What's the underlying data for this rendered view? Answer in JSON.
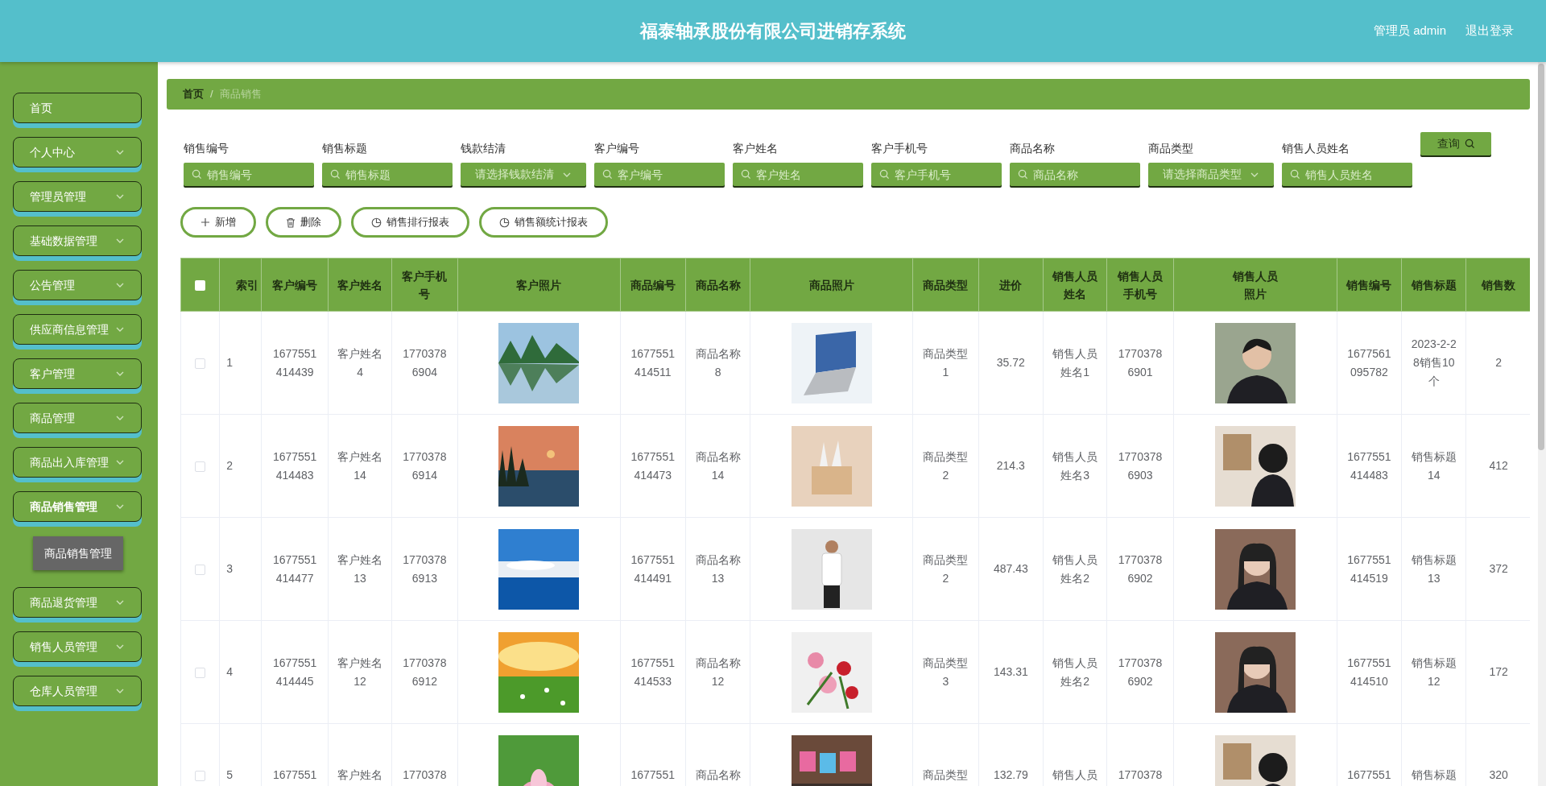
{
  "header": {
    "title": "福泰轴承股份有限公司进销存系统",
    "user": "管理员 admin",
    "logout": "退出登录"
  },
  "sidebar": {
    "items": [
      {
        "label": "首页",
        "kind": "link",
        "expanded": false
      },
      {
        "label": "个人中心",
        "kind": "menu",
        "expanded": false
      },
      {
        "label": "管理员管理",
        "kind": "menu",
        "expanded": false
      },
      {
        "label": "基础数据管理",
        "kind": "menu",
        "expanded": false
      },
      {
        "label": "公告管理",
        "kind": "menu",
        "expanded": false
      },
      {
        "label": "供应商信息管理",
        "kind": "menu",
        "expanded": false
      },
      {
        "label": "客户管理",
        "kind": "menu",
        "expanded": false
      },
      {
        "label": "商品管理",
        "kind": "menu",
        "expanded": false
      },
      {
        "label": "商品出入库管理",
        "kind": "menu",
        "expanded": false
      },
      {
        "label": "商品销售管理",
        "kind": "menu",
        "expanded": true,
        "children": [
          {
            "label": "商品销售管理",
            "selected": true
          }
        ]
      },
      {
        "label": "商品退货管理",
        "kind": "menu",
        "expanded": false
      },
      {
        "label": "销售人员管理",
        "kind": "menu",
        "expanded": false
      },
      {
        "label": "仓库人员管理",
        "kind": "menu",
        "expanded": false
      }
    ]
  },
  "breadcrumb": {
    "separator": "/",
    "items": [
      "首页",
      "商品销售"
    ]
  },
  "filters": [
    {
      "label": "销售编号",
      "kind": "search",
      "placeholder": "销售编号"
    },
    {
      "label": "销售标题",
      "kind": "search",
      "placeholder": "销售标题"
    },
    {
      "label": "钱款结清",
      "kind": "select",
      "placeholder": "请选择钱款结清"
    },
    {
      "label": "客户编号",
      "kind": "search",
      "placeholder": "客户编号"
    },
    {
      "label": "客户姓名",
      "kind": "search",
      "placeholder": "客户姓名"
    },
    {
      "label": "客户手机号",
      "kind": "search",
      "placeholder": "客户手机号"
    },
    {
      "label": "商品名称",
      "kind": "search",
      "placeholder": "商品名称"
    },
    {
      "label": "商品类型",
      "kind": "select",
      "placeholder": "请选择商品类型"
    },
    {
      "label": "销售人员姓名",
      "kind": "search",
      "placeholder": "销售人员姓名"
    }
  ],
  "query_button": "查询",
  "actions": [
    {
      "label": "新增",
      "kind": "add"
    },
    {
      "label": "删除",
      "kind": "delete"
    },
    {
      "label": "销售排行报表",
      "kind": "report"
    },
    {
      "label": "销售额统计报表",
      "kind": "report"
    }
  ],
  "table": {
    "select_all": {
      "checked": false
    },
    "columns": [
      {
        "label": "索引",
        "kind": "text"
      },
      {
        "label": "客户编号",
        "kind": "text"
      },
      {
        "label": "客户姓名",
        "kind": "text"
      },
      {
        "label": "客户手机号",
        "kind": "text"
      },
      {
        "label": "客户照片",
        "kind": "picture"
      },
      {
        "label": "商品编号",
        "kind": "text"
      },
      {
        "label": "商品名称",
        "kind": "text"
      },
      {
        "label": "商品照片",
        "kind": "picture"
      },
      {
        "label": "商品类型",
        "kind": "text"
      },
      {
        "label": "进价",
        "kind": "text"
      },
      {
        "label": "销售人员姓名",
        "kind": "text"
      },
      {
        "label": "销售人员手机号",
        "kind": "text"
      },
      {
        "label": "销售人员照片",
        "kind": "picture"
      },
      {
        "label": "销售编号",
        "kind": "text"
      },
      {
        "label": "销售标题",
        "kind": "text"
      },
      {
        "label": "销售数",
        "kind": "text"
      }
    ],
    "rows": [
      {
        "checked": false,
        "cells": [
          "1",
          "1677551414439",
          "客户姓名4",
          "17703786904",
          null,
          "1677551414511",
          "商品名称8",
          null,
          "商品类型1",
          "35.72",
          "销售人员姓名1",
          "17703786901",
          null,
          "1677561095782",
          "2023-2-28销售10个",
          "2"
        ]
      },
      {
        "checked": false,
        "cells": [
          "2",
          "1677551414483",
          "客户姓名14",
          "17703786914",
          null,
          "1677551414473",
          "商品名称14",
          null,
          "商品类型2",
          "214.3",
          "销售人员姓名3",
          "17703786903",
          null,
          "1677551414483",
          "销售标题14",
          "412"
        ]
      },
      {
        "checked": false,
        "cells": [
          "3",
          "1677551414477",
          "客户姓名13",
          "17703786913",
          null,
          "1677551414491",
          "商品名称13",
          null,
          "商品类型2",
          "487.43",
          "销售人员姓名2",
          "17703786902",
          null,
          "1677551414519",
          "销售标题13",
          "372"
        ]
      },
      {
        "checked": false,
        "cells": [
          "4",
          "1677551414445",
          "客户姓名12",
          "17703786912",
          null,
          "1677551414533",
          "商品名称12",
          null,
          "商品类型3",
          "143.31",
          "销售人员姓名2",
          "17703786902",
          null,
          "1677551414510",
          "销售标题12",
          "172"
        ]
      },
      {
        "checked": false,
        "cells": [
          "5",
          "1677551",
          "客户姓名",
          "1770378",
          null,
          "1677551",
          "商品名称",
          null,
          "商品类型",
          "132.79",
          "销售人员",
          "1770378",
          null,
          "1677551",
          "销售标题",
          "320"
        ]
      }
    ]
  }
}
